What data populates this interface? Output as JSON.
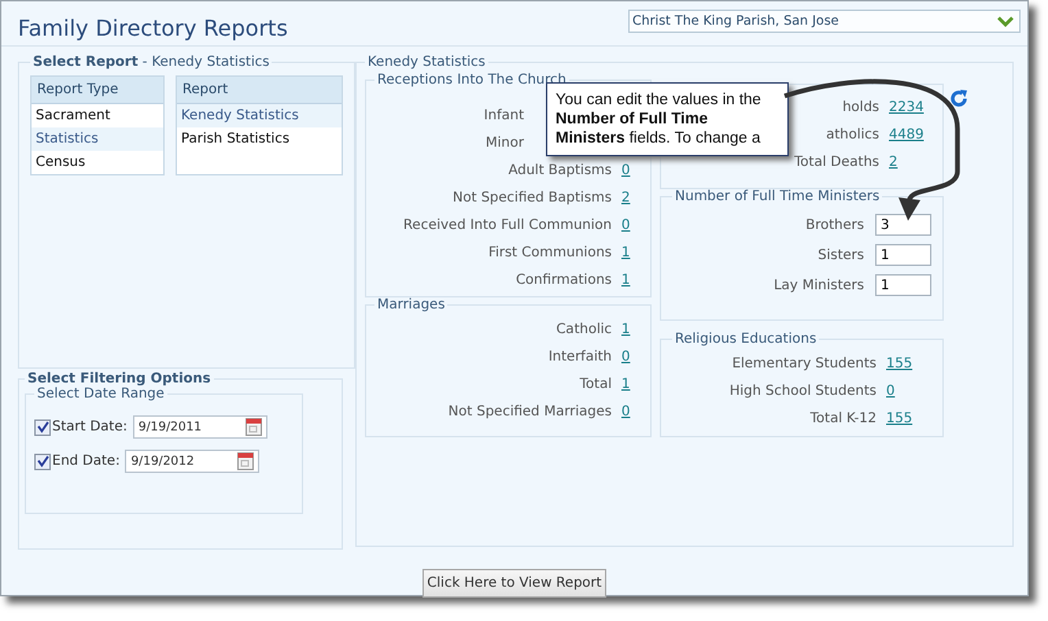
{
  "window": {
    "title": "Family Directory Reports"
  },
  "parish_dropdown": {
    "value": "Christ The King Parish, San Jose"
  },
  "select_report": {
    "legend": "**Select Report** - Kenedy Statistics",
    "report_type": {
      "header": "Report Type",
      "items": [
        {
          "label": "Sacrament",
          "selected": false
        },
        {
          "label": "Statistics",
          "selected": true
        },
        {
          "label": "Census",
          "selected": false
        }
      ]
    },
    "report": {
      "header": "Report",
      "items": [
        {
          "label": "Kenedy Statistics",
          "selected": true
        },
        {
          "label": "Parish Statistics",
          "selected": false
        }
      ]
    }
  },
  "filtering": {
    "title": "Select Filtering Options",
    "date_range": {
      "title": "Select Date Range",
      "fields": [
        {
          "label": "Start Date:",
          "value": "9/19/2011",
          "checked": true
        },
        {
          "label": "End Date:",
          "value": "9/19/2012",
          "checked": true
        }
      ]
    }
  },
  "statistics": {
    "title": "Kenedy Statistics",
    "receptions": {
      "title": "Receptions Into The Church",
      "rows": [
        {
          "label": "Infant"
        },
        {
          "label": "Minor"
        },
        {
          "label": "Adult Baptisms",
          "value": "0"
        },
        {
          "label": "Not Specified Baptisms",
          "value": "2"
        },
        {
          "label": "Received Into Full Communion",
          "value": "0"
        },
        {
          "label": "First Communions",
          "value": "1"
        },
        {
          "label": "Confirmations",
          "value": "1"
        }
      ]
    },
    "marriages": {
      "title": "Marriages",
      "rows": [
        {
          "label": "Catholic",
          "value": "1"
        },
        {
          "label": "Interfaith",
          "value": "0"
        },
        {
          "label": "Total",
          "value": "1"
        },
        {
          "label": "Not Specified Marriages",
          "value": "0"
        }
      ]
    },
    "totals": {
      "rows": [
        {
          "label": "holds",
          "value": "2234"
        },
        {
          "label": "atholics",
          "value": "4489"
        },
        {
          "label": "Total Deaths",
          "value": "2"
        }
      ]
    },
    "ministers": {
      "title": "Number of Full Time Ministers",
      "fields": [
        {
          "label": "Brothers",
          "value": "3"
        },
        {
          "label": "Sisters",
          "value": "1"
        },
        {
          "label": "Lay Ministers",
          "value": "1"
        }
      ]
    },
    "religious_education": {
      "title": "Religious Educations",
      "rows": [
        {
          "label": "Elementary Students",
          "value": "155"
        },
        {
          "label": "High School Students",
          "value": "0"
        },
        {
          "label": "Total K-12",
          "value": "155"
        }
      ]
    }
  },
  "view_button": {
    "label": "Click Here to View Report"
  },
  "callout": {
    "text": "You can edit the values in  the **Number of Full Time Ministers** fields. To change a"
  }
}
